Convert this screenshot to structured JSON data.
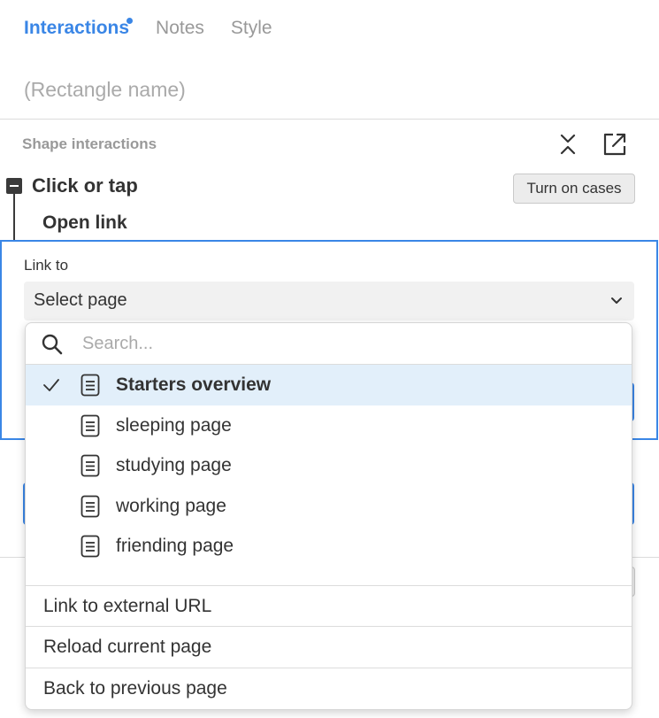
{
  "tabs": [
    {
      "label": "Interactions",
      "active": true,
      "has_dot": true
    },
    {
      "label": "Notes",
      "active": false
    },
    {
      "label": "Style",
      "active": false
    }
  ],
  "shape_name_placeholder": "(Rectangle name)",
  "shape_interactions": {
    "label": "Shape interactions",
    "collapse_icon": "collapse-icon",
    "popout_icon": "popout-icon"
  },
  "event": {
    "label": "Click or tap",
    "turn_on_cases_label": "Turn on cases"
  },
  "action": {
    "label": "Open link",
    "link_to_label": "Link to",
    "select_value": "Select page"
  },
  "dropdown": {
    "search_placeholder": "Search...",
    "pages": [
      {
        "label": "Starters overview",
        "selected": true
      },
      {
        "label": "sleeping page",
        "selected": false
      },
      {
        "label": "studying page",
        "selected": false
      },
      {
        "label": "working page",
        "selected": false
      },
      {
        "label": "friending page",
        "selected": false
      }
    ],
    "actions": [
      {
        "label": "Link to external URL"
      },
      {
        "label": "Reload current page"
      },
      {
        "label": "Back to previous page"
      }
    ]
  },
  "colors": {
    "accent": "#3a86e6",
    "selected_bg": "#e2effa"
  }
}
